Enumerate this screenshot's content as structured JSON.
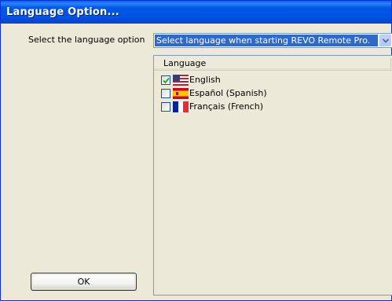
{
  "window": {
    "title": "Language Option..."
  },
  "form": {
    "language_label": "Select the language option",
    "combo_value": "Select language when starting REVO Remote Pro."
  },
  "list": {
    "header": "Language",
    "items": [
      {
        "label": "English",
        "checked": true,
        "flag": "us-flag-icon"
      },
      {
        "label": "Español (Spanish)",
        "checked": false,
        "flag": "spain-flag-icon"
      },
      {
        "label": "Français (French)",
        "checked": false,
        "flag": "france-flag-icon"
      }
    ]
  },
  "buttons": {
    "ok": "OK"
  },
  "colors": {
    "titlebar": "#0054e3",
    "selection": "#316ac5",
    "face": "#ece9d8"
  }
}
